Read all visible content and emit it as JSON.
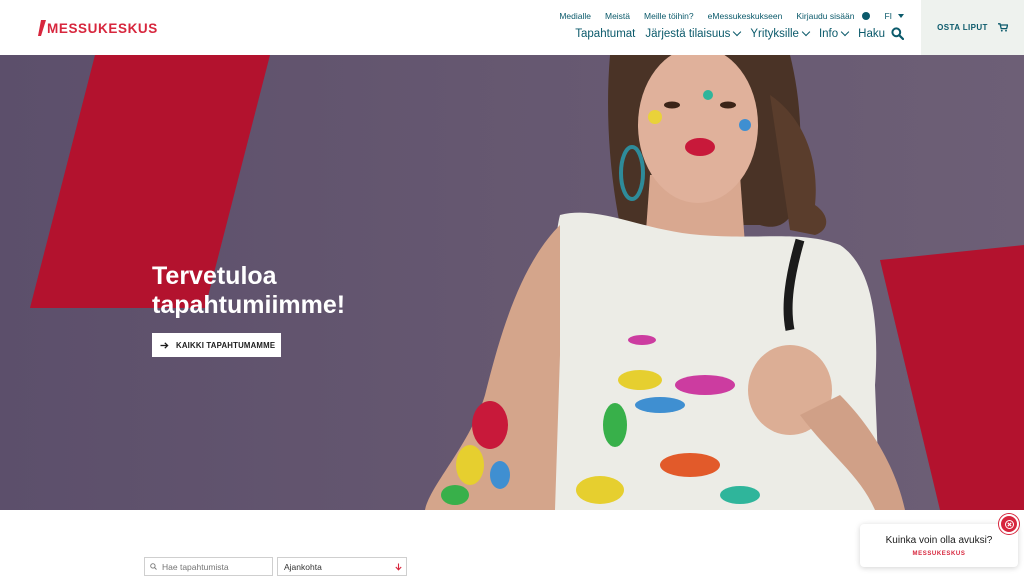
{
  "header": {
    "logo_text": "MESSUKESKUS",
    "top_links": [
      "Medialle",
      "Meistä",
      "Meille töihin?",
      "eMessukeskukseen"
    ],
    "login_label": "Kirjaudu sisään",
    "language": "FI",
    "main_nav": [
      {
        "label": "Tapahtumat",
        "has_dropdown": false
      },
      {
        "label": "Järjestä tilaisuus",
        "has_dropdown": true
      },
      {
        "label": "Yrityksille",
        "has_dropdown": true
      },
      {
        "label": "Info",
        "has_dropdown": true
      },
      {
        "label": "Haku",
        "has_dropdown": false
      }
    ],
    "tickets_label": "OSTA LIPUT"
  },
  "hero": {
    "title_line1": "Tervetuloa",
    "title_line2": "tapahtumiimme!",
    "button_label": "KAIKKI TAPAHTUMAMME"
  },
  "search": {
    "placeholder": "Hae tapahtumista",
    "time_label": "Ajankohta"
  },
  "chat": {
    "question": "Kuinka voin olla avuksi?",
    "logo_text": "MESSUKESKUS"
  },
  "colors": {
    "brand_red": "#d7263d",
    "brand_teal": "#0b5a6b",
    "hero_bg": "#655770"
  },
  "icons": [
    "user-icon",
    "caret-down-icon",
    "search-icon",
    "cart-icon",
    "arrow-right-icon",
    "close-icon"
  ]
}
